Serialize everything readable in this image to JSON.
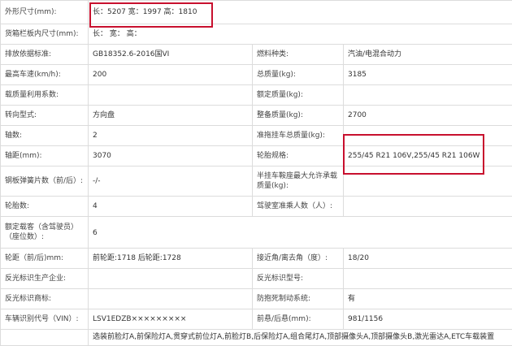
{
  "highlight_color": "#c8102e",
  "rows": [
    {
      "cells": [
        {
          "label": "外形尺寸(mm):"
        },
        {
          "value": "长：5207 宽：1997 高：1810"
        }
      ]
    },
    {
      "cells": [
        {
          "label": "货箱栏板内尺寸(mm):"
        },
        {
          "value": "长：   宽：   高："
        }
      ]
    },
    {
      "cells": [
        {
          "label": "排放依据标准:"
        },
        {
          "value": "GB18352.6-2016国VI"
        },
        {
          "label": "燃料种类:"
        },
        {
          "value": "汽油/电混合动力"
        }
      ]
    },
    {
      "cells": [
        {
          "label": "最高车速(km/h):"
        },
        {
          "value": "200"
        },
        {
          "label": "总质量(kg):"
        },
        {
          "value": "3185"
        }
      ]
    },
    {
      "cells": [
        {
          "label": "载质量利用系数:"
        },
        {
          "value": ""
        },
        {
          "label": "额定质量(kg):"
        },
        {
          "value": ""
        }
      ]
    },
    {
      "cells": [
        {
          "label": "转向型式:"
        },
        {
          "value": "方向盘"
        },
        {
          "label": "整备质量(kg):"
        },
        {
          "value": "2700"
        }
      ]
    },
    {
      "cells": [
        {
          "label": "轴数:"
        },
        {
          "value": "2"
        },
        {
          "label": "准拖挂车总质量(kg):"
        },
        {
          "value": ""
        }
      ]
    },
    {
      "cells": [
        {
          "label": "轴距(mm):"
        },
        {
          "value": "3070"
        },
        {
          "label": "轮胎规格:"
        },
        {
          "value": "255/45 R21 106V,255/45 R21 106W"
        }
      ]
    },
    {
      "cells": [
        {
          "label": "钢板弹簧片数（前/后）:"
        },
        {
          "value": "-/-"
        },
        {
          "label": "半挂车鞍座最大允许承载质量(kg):"
        },
        {
          "value": ""
        }
      ]
    },
    {
      "cells": [
        {
          "label": "轮胎数:"
        },
        {
          "value": "4"
        },
        {
          "label": "驾驶室准乘人数（人）:"
        },
        {
          "value": ""
        }
      ]
    },
    {
      "cells": [
        {
          "label": "额定载客（含驾驶员）（座位数）:"
        },
        {
          "value": "6"
        }
      ]
    },
    {
      "cells": [
        {
          "label": "轮距（前/后)mm:"
        },
        {
          "value": "前轮距:1718 后轮距:1728"
        },
        {
          "label": "接近角/离去角（度）:"
        },
        {
          "value": "18/20"
        }
      ]
    },
    {
      "cells": [
        {
          "label": "反光标识生产企业:"
        },
        {
          "value": ""
        },
        {
          "label": "反光标识型号:"
        },
        {
          "value": ""
        }
      ]
    },
    {
      "cells": [
        {
          "label": "反光标识商标:"
        },
        {
          "value": ""
        },
        {
          "label": "防抱死制动系统:"
        },
        {
          "value": "有"
        }
      ]
    },
    {
      "cells": [
        {
          "label": "车辆识别代号（VIN）:"
        },
        {
          "value": "LSV1EDZB×××××××××"
        },
        {
          "label": "前悬/后悬(mm):"
        },
        {
          "value": "981/1156"
        }
      ]
    },
    {
      "cells": [
        {
          "label": ""
        },
        {
          "value": "选装前脸灯A,前保险灯A,贯穿式前位灯A,前脸灯B,后保险灯A,组合尾灯A,顶部摄像头A,顶部摄像头B,激光雷达A,ETC车载装置"
        }
      ]
    }
  ]
}
